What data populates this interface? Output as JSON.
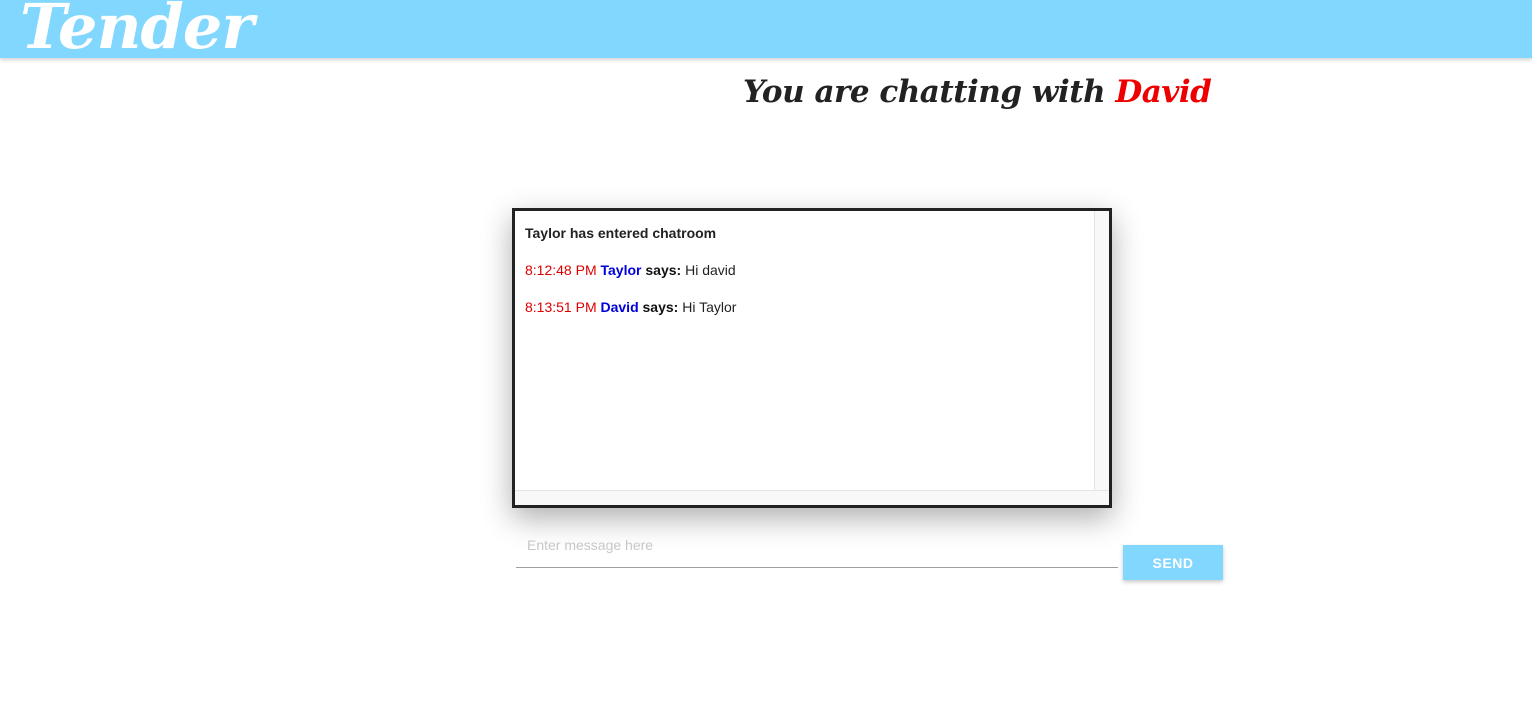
{
  "app": {
    "brand": "Tender"
  },
  "header": {
    "prefix": "You are chatting with ",
    "partner_name": "David"
  },
  "chat": {
    "system_message": "Taylor has entered chatroom",
    "messages": [
      {
        "time": "8:12:48 PM",
        "sender": "Taylor",
        "says": "says:",
        "text": "Hi david"
      },
      {
        "time": "8:13:51 PM",
        "sender": "David",
        "says": "says:",
        "text": "Hi Taylor"
      }
    ]
  },
  "composer": {
    "placeholder": "Enter message here",
    "value": "",
    "send_label": "SEND"
  },
  "colors": {
    "topbar": "#81d7fd",
    "partner_name": "#ee0000",
    "timestamp": "#dd0000",
    "sender": "#0000dd",
    "send_button": "#81d7fd"
  }
}
